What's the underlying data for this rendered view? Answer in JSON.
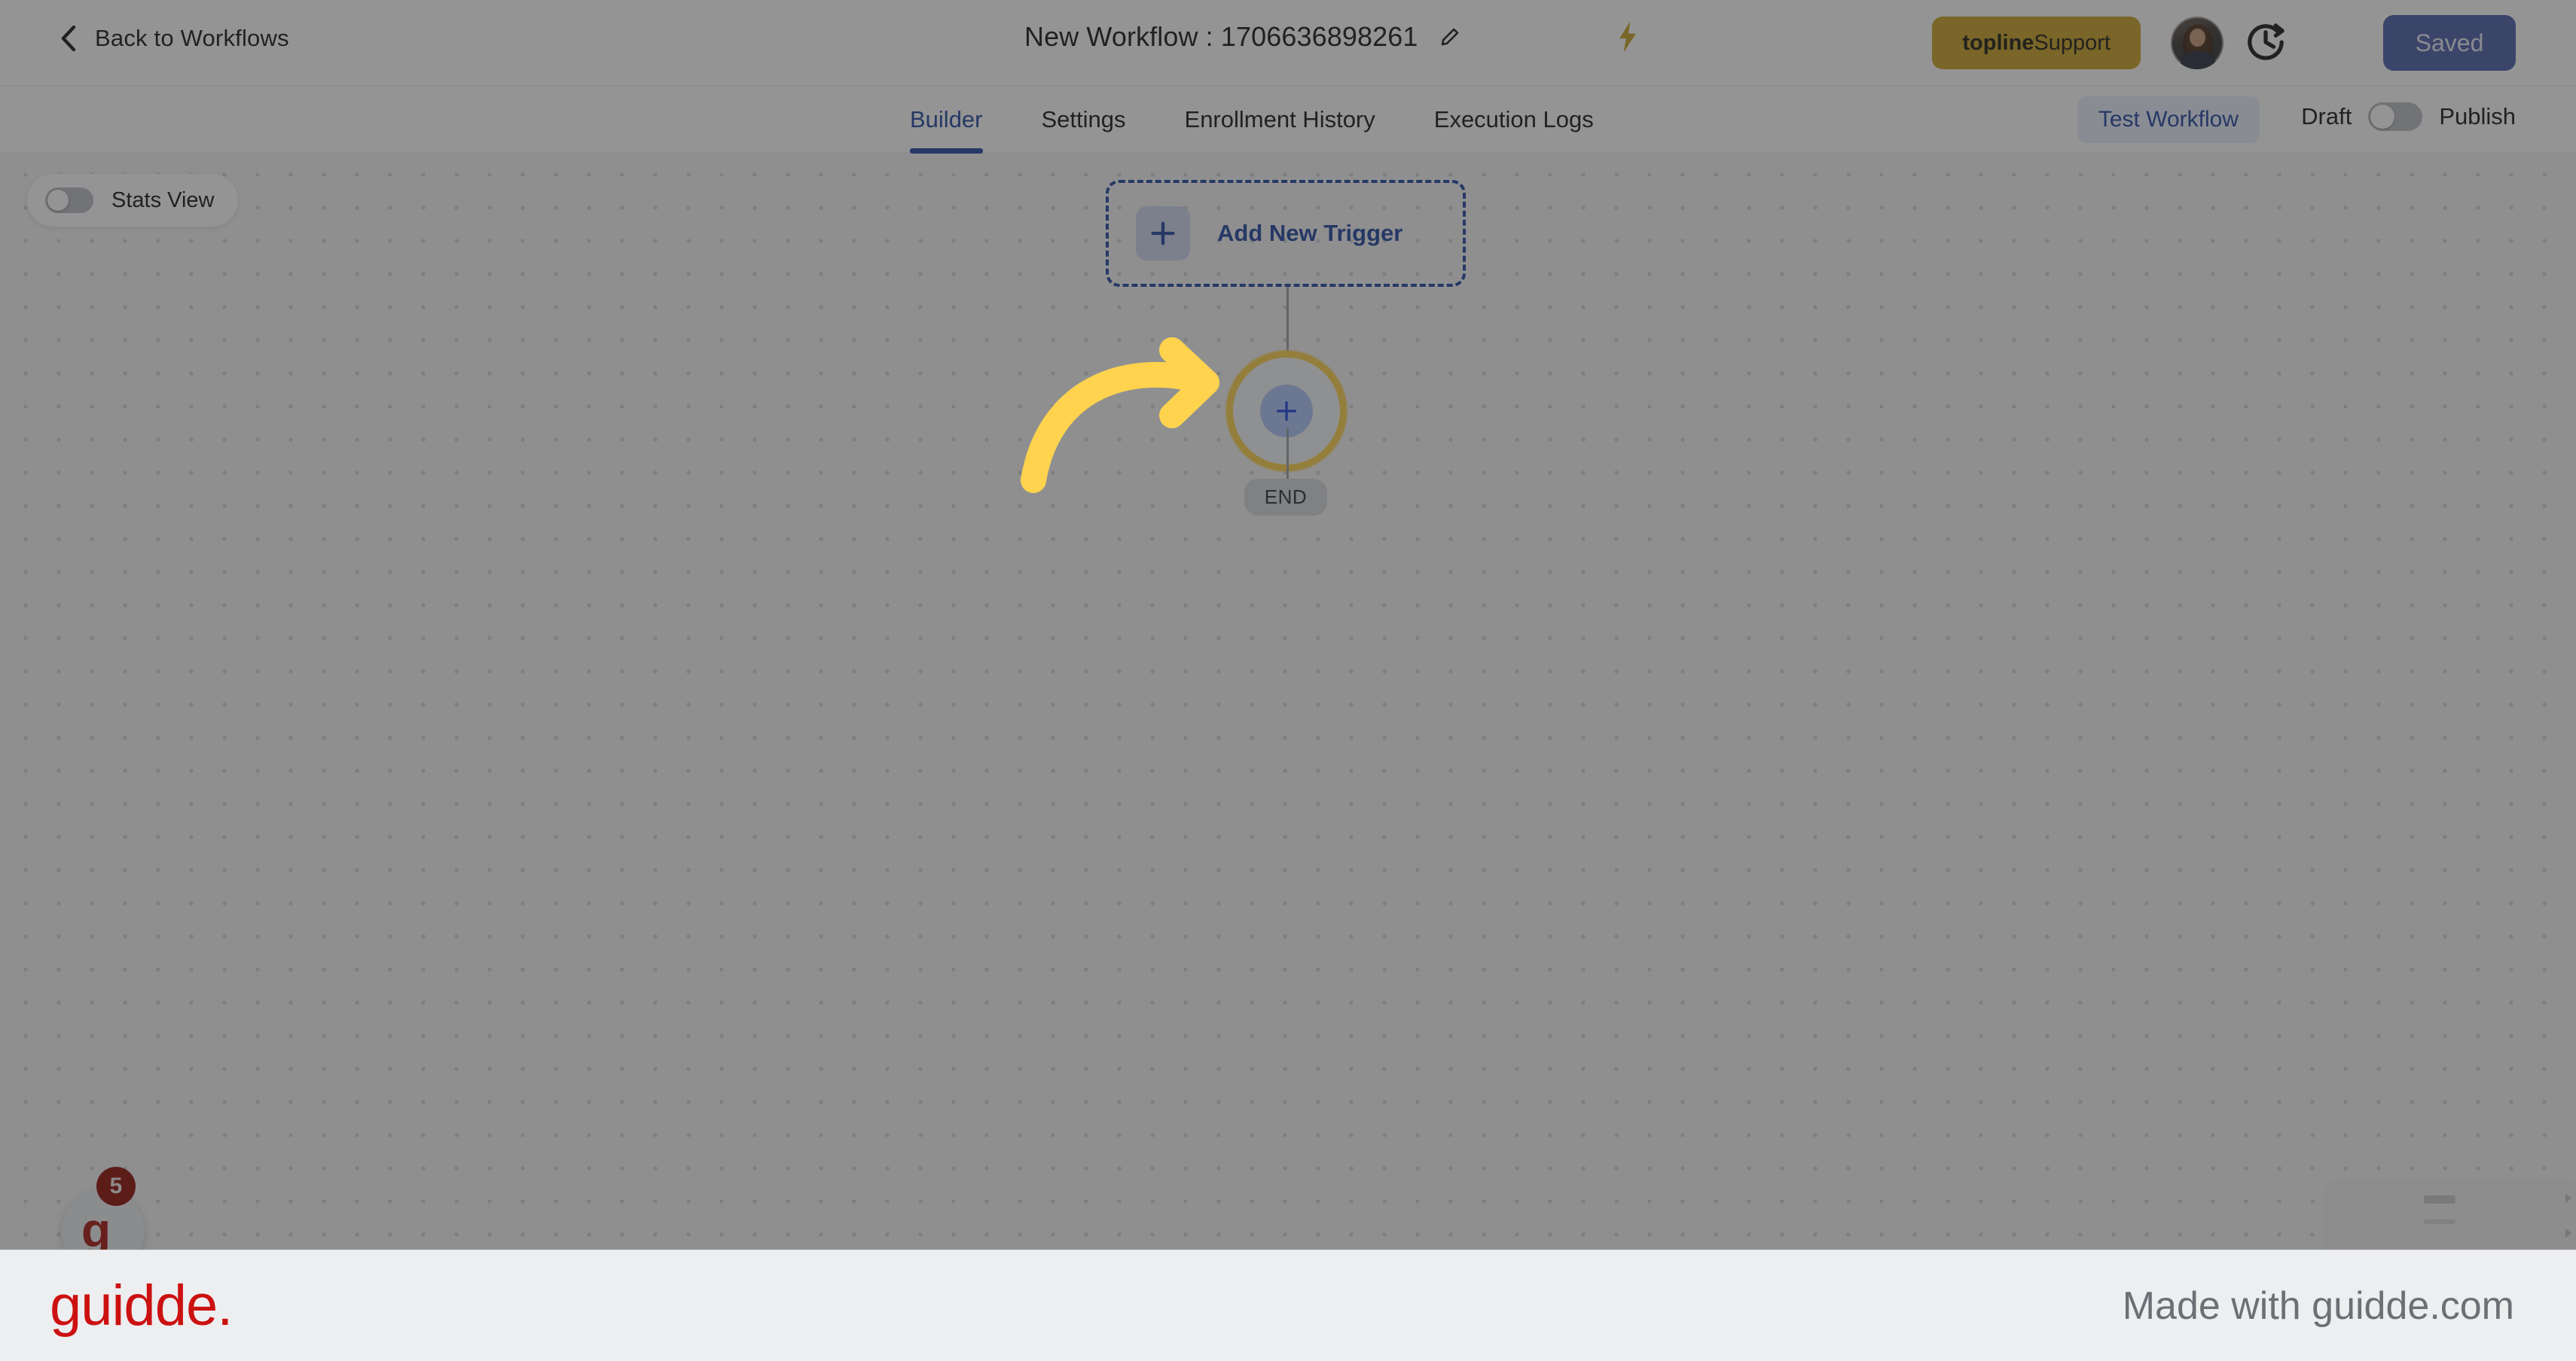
{
  "header": {
    "back_label": "Back to Workflows",
    "back_icon": "chevron-left-icon",
    "title": "New Workflow : 1706636898261",
    "edit_icon": "pencil-icon",
    "bolt_icon": "lightning-bolt-icon",
    "support_button": {
      "brand": "topline",
      "text": " Support",
      "color": "#c9a227"
    },
    "avatar_alt": "user-avatar",
    "history_icon": "clock-history-icon",
    "save_state": "Saved",
    "save_color": "#4c5fa8"
  },
  "tabs": {
    "items": [
      {
        "label": "Builder",
        "active": true
      },
      {
        "label": "Settings",
        "active": false
      },
      {
        "label": "Enrollment History",
        "active": false
      },
      {
        "label": "Execution Logs",
        "active": false
      }
    ],
    "active_color": "#2346a0",
    "test_workflow_label": "Test Workflow",
    "draft_label": "Draft",
    "publish_label": "Publish",
    "publish_toggle_on": false
  },
  "canvas": {
    "stats_view_label": "Stats View",
    "stats_view_on": false,
    "trigger": {
      "label": "Add New Trigger",
      "plus_icon": "plus-icon",
      "accent": "#2346a0"
    },
    "add_node": {
      "icon": "plus-icon",
      "highlight_color": "#ffd34e",
      "inner_color": "#aec6fb"
    },
    "end_label": "END"
  },
  "widgets": {
    "chat_badge_count": "5",
    "chat_glyph": "g"
  },
  "footer": {
    "logo": "guidde.",
    "logo_color": "#cc1111",
    "made_with": "Made with guidde.com"
  },
  "highlight": {
    "arrow_icon": "curved-arrow-icon",
    "arrow_color": "#ffd34e"
  }
}
